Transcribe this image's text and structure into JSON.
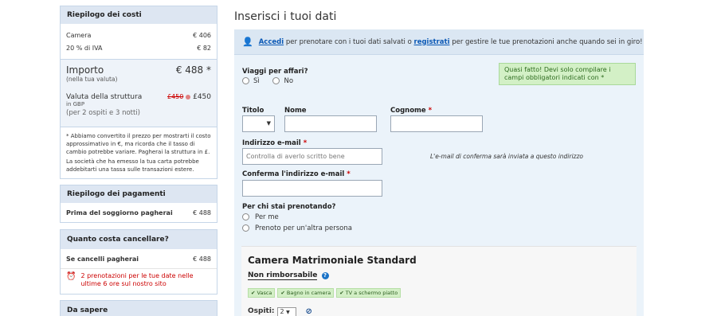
{
  "cost_summary": {
    "title": "Riepilogo dei costi",
    "rows": [
      {
        "label": "Camera",
        "value": "€ 406"
      },
      {
        "label": "20 % di IVA",
        "value": "€ 82"
      }
    ],
    "importo_label": "Importo",
    "importo_sub": "(nella tua valuta)",
    "importo_value": "€ 488 *",
    "valuta_label": "Valuta della struttura",
    "valuta_sub": "in GBP",
    "valuta_old": "£450",
    "valuta_new": "£450",
    "guests": "(per 2 ospiti e 3 notti)",
    "note1": "* Abbiamo convertito il prezzo per mostrarti il costo approssimativo in €, ma ricorda che il tasso di cambio potrebbe variare. Pagherai la struttura in £.",
    "note2": "La società che ha emesso la tua carta potrebbe addebitarti una tassa sulle transazioni estere."
  },
  "payment_summary": {
    "title": "Riepilogo dei pagamenti",
    "row_label": "Prima del soggiorno pagherai",
    "row_value": "€ 488"
  },
  "cancel_cost": {
    "title": "Quanto costa cancellare?",
    "row_label": "Se cancelli pagherai",
    "row_value": "€ 488",
    "alert": "2 prenotazioni per le tue date nelle ultime 6 ore sul nostro sito"
  },
  "know": {
    "title": "Da sapere"
  },
  "form": {
    "heading": "Inserisci i tuoi dati",
    "login_link": "Accedi",
    "login_mid": "per prenotare con i tuoi dati salvati o",
    "register_link": "registrati",
    "login_end": "per gestire le tue prenotazioni anche quando sei in giro!",
    "business_q": "Viaggi per affari?",
    "yes": "Sì",
    "no": "No",
    "ok_msg": "Quasi fatto! Devi solo compilare i campi obbligatori indicati con *",
    "title_label": "Titolo",
    "name_label": "Nome",
    "surname_label": "Cognome",
    "email_label": "Indirizzo e-mail",
    "email_placeholder": "Controlla di averlo scritto bene",
    "email_hint": "L'e-mail di conferma sarà inviata a questo indirizzo",
    "confirm_label": "Conferma l'indirizzo e-mail",
    "for_whom_q": "Per chi stai prenotando?",
    "for_me": "Per me",
    "for_other": "Prenoto per un'altra persona",
    "required_mark": "*"
  },
  "room": {
    "name": "Camera Matrimoniale Standard",
    "rate": "Non rimborsabile",
    "amenities": [
      "Vasca",
      "Bagno in camera",
      "TV a schermo piatto"
    ],
    "guests_label": "Ospiti:",
    "guests_value": "2"
  }
}
